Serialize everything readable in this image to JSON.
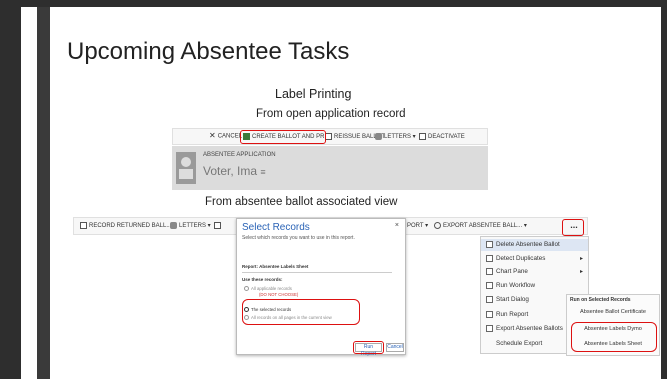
{
  "slide": {
    "title": "Upcoming Absentee Tasks",
    "subtitle": "Label Printing",
    "caption_open": "From open application record",
    "caption_view": "From absentee ballot associated view"
  },
  "cmdbar1": {
    "cancel": "CANCEL",
    "create": "CREATE BALLOT AND PRI...",
    "reissue": "REISSUE BALLOT",
    "letters": "LETTERS",
    "deactivate": "DEACTIVATE"
  },
  "record": {
    "type": "ABSENTEE APPLICATION",
    "name": "Voter, Ima"
  },
  "cmdbar2": {
    "record_returned": "RECORD RETURNED BALL...",
    "letters": "LETTERS",
    "export_prefix": "PORT",
    "export_absentee": "EXPORT ABSENTEE BALL...",
    "more": "..."
  },
  "dialog": {
    "title": "Select Records",
    "close": "×",
    "subtitle": "Select which records you want to use in this report.",
    "report": "Report: Absentee Labels Sheet",
    "use_these": "Use these records:",
    "opt_all": "All applicable records",
    "opt_all_note": "(DO NOT CHOOSE)",
    "opt_selected": "The selected records",
    "opt_all_pages": "All records on all pages in the current view",
    "run": "Run Report",
    "cancel": "Cancel"
  },
  "menu": {
    "items": [
      "Delete Absentee Ballot",
      "Detect Duplicates",
      "Chart Pane",
      "Run Workflow",
      "Start Dialog",
      "Run Report",
      "Export Absentee Ballots",
      "Schedule Export"
    ]
  },
  "submenu": {
    "header": "Run on Selected Records",
    "items": [
      "Absentee Ballot Certificate",
      "Absentee Labels Dymo",
      "Absentee Labels Sheet"
    ]
  },
  "colors": {
    "accent_red": "#d11111",
    "link_blue": "#2a63b6",
    "dark_bar": "#3a3a3a"
  }
}
